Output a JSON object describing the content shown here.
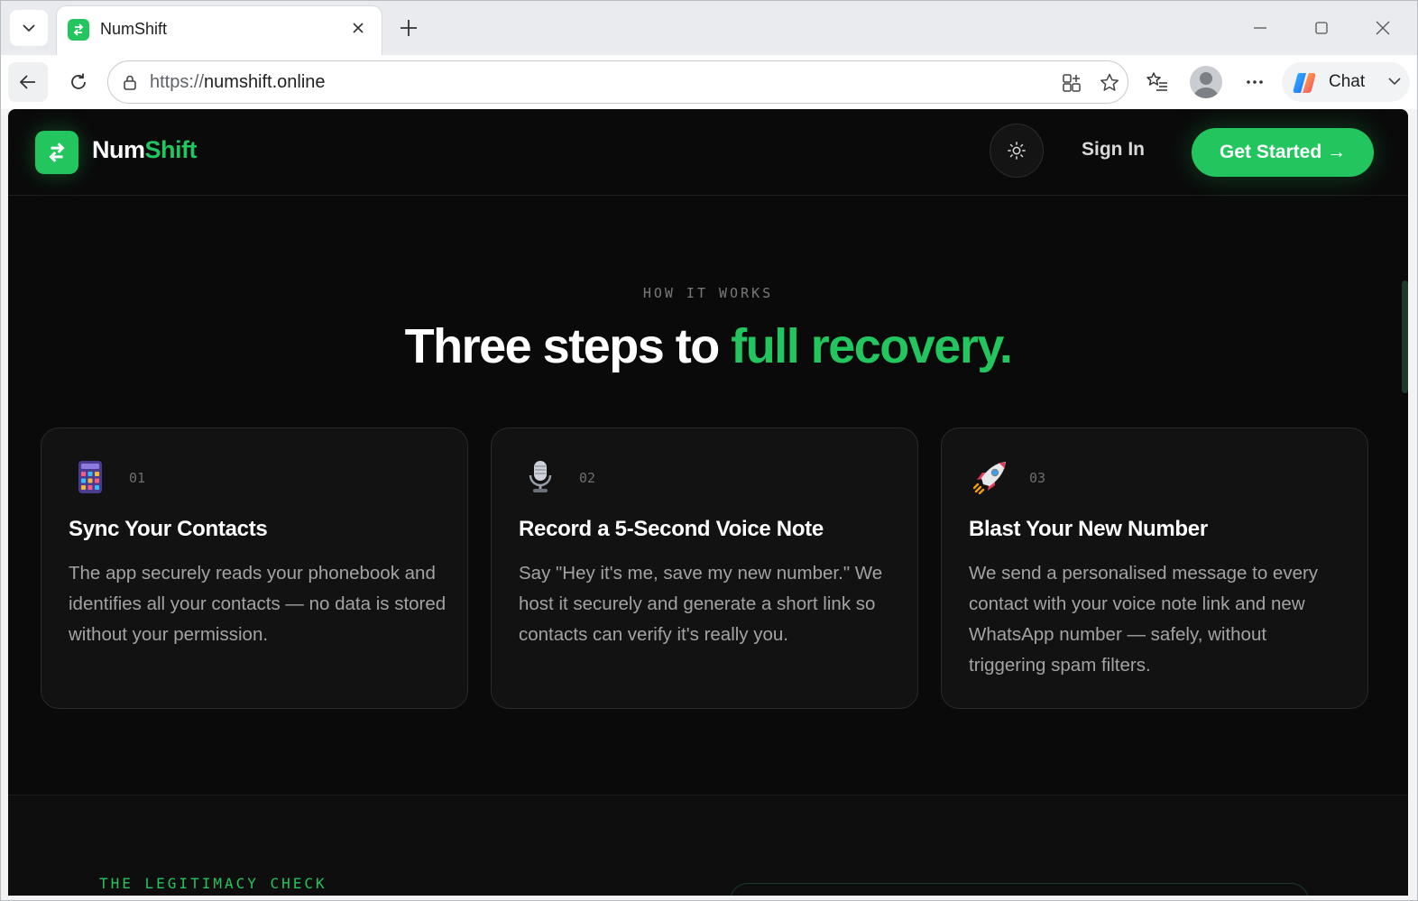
{
  "browser": {
    "tab": {
      "title": "NumShift"
    },
    "url": {
      "scheme": "https://",
      "host": "numshift.online"
    },
    "chat_label": "Chat"
  },
  "site": {
    "brand": {
      "part1": "Num",
      "part2": "Shift"
    },
    "nav": {
      "sign_in": "Sign In",
      "get_started": "Get Started →"
    },
    "colors": {
      "accent": "#22c55e",
      "background": "#0a0a0a"
    }
  },
  "how_it_works": {
    "label": "HOW IT WORKS",
    "headline_main": "Three steps to ",
    "headline_accent": "full recovery.",
    "steps": [
      {
        "icon": "phone-keypad-icon",
        "number": "01",
        "title": "Sync Your Contacts",
        "description": "The app securely reads your phonebook and identifies all your contacts — no data is stored without your permission."
      },
      {
        "icon": "microphone-icon",
        "number": "02",
        "title": "Record a 5-Second Voice Note",
        "description": "Say \"Hey it's me, save my new number.\" We host it securely and generate a short link so contacts can verify it's really you."
      },
      {
        "icon": "rocket-icon",
        "number": "03",
        "title": "Blast Your New Number",
        "description": "We send a personalised message to every contact with your voice note link and new WhatsApp number — safely, without triggering spam filters."
      }
    ]
  },
  "legitimacy": {
    "label": "THE LEGITIMACY CHECK"
  }
}
